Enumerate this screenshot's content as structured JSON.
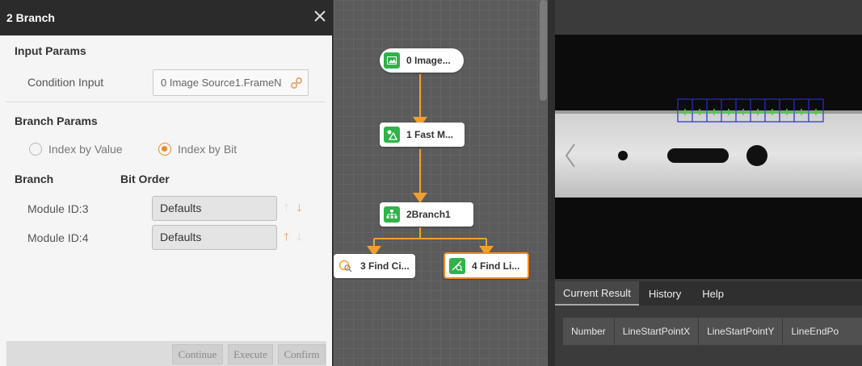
{
  "dialog": {
    "title": "2 Branch",
    "input_params": {
      "heading": "Input Params",
      "condition_label": "Condition Input",
      "condition_value": "0 Image Source1.FrameN"
    },
    "branch_params": {
      "heading": "Branch Params",
      "radio_value": "Index by Value",
      "radio_bit": "Index by Bit",
      "selected": "Index by Bit",
      "col_branch": "Branch",
      "col_bit_order": "Bit Order",
      "rows": [
        {
          "label": "Module ID:3",
          "value": "Defaults"
        },
        {
          "label": "Module ID:4",
          "value": "Defaults"
        }
      ]
    },
    "buttons": {
      "continue": "Continue",
      "execute": "Execute",
      "confirm": "Confirm"
    }
  },
  "flow": {
    "nodes": [
      {
        "label": "0 Image...",
        "icon": "image-icon"
      },
      {
        "label": "1 Fast M...",
        "icon": "fast-match-icon"
      },
      {
        "label": "2Branch1",
        "icon": "branch-icon"
      },
      {
        "label": "3 Find Ci...",
        "icon": "find-circle-icon"
      },
      {
        "label": "4 Find Li...",
        "icon": "find-line-icon"
      }
    ],
    "accent": "#f0a030",
    "node_icon_bg": "#2fb34a"
  },
  "result": {
    "tabs": [
      "Current Result",
      "History",
      "Help"
    ],
    "active_tab": "Current Result",
    "columns": [
      "Number",
      "LineStartPointX",
      "LineStartPointY",
      "LineEndPo"
    ]
  },
  "colors": {
    "selection": "#f08a24",
    "roi": "#2a2ae0"
  }
}
